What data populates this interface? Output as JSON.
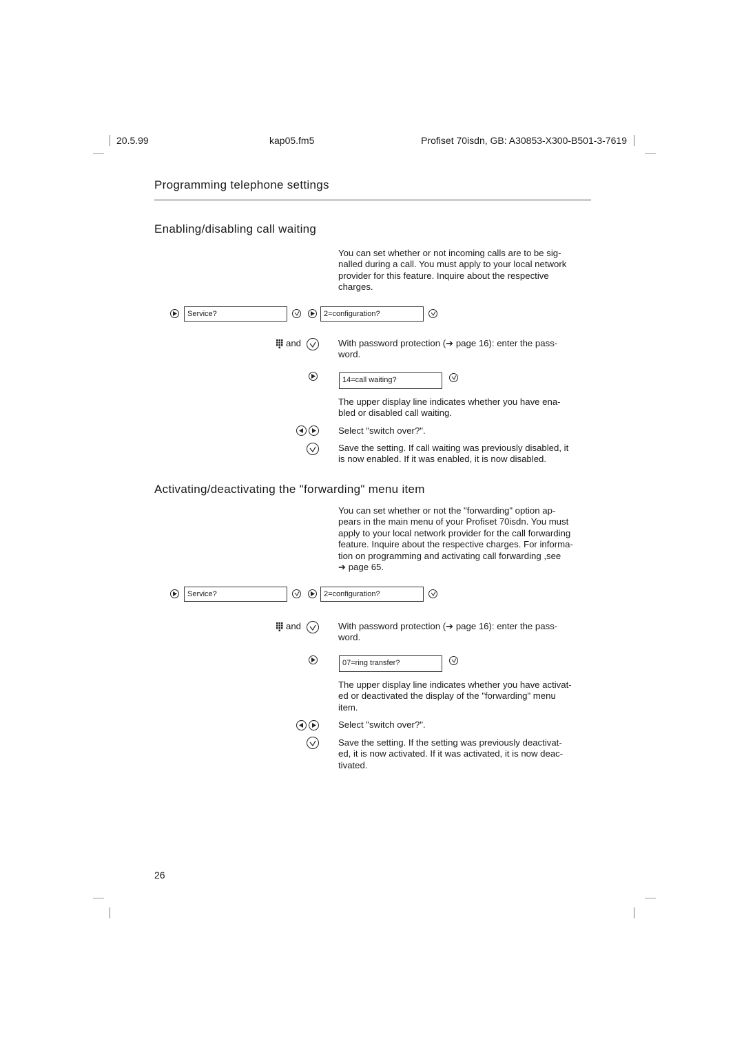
{
  "header": {
    "date": "20.5.99",
    "file": "kap05.fm5",
    "doc_id": "Profiset 70isdn, GB: A30853-X300-B501-3-7619"
  },
  "chapter_title": "Programming telephone settings",
  "sections": [
    {
      "title": "Enabling/disabling call waiting",
      "intro": "You can set whether or not incoming calls are to be sig- nalled during a call. You must apply to your local network provider for this feature. Inquire about the respective charges.",
      "intro_lines": [
        "You can set whether or not incoming calls are to be sig-",
        "nalled during a call. You must apply to your local network",
        "provider for this feature. Inquire about the respective",
        "charges."
      ],
      "display_service": "Service?",
      "display_config": "2=configuration?",
      "keypad_and": "and",
      "password_lines": [
        "With password protection (➔ page 16): enter the pass-",
        "word."
      ],
      "display_item": "14=call waiting?",
      "upper_lines": [
        "The upper display line indicates whether you have ena-",
        "bled or disabled call waiting."
      ],
      "select_text": "Select \"switch over?\".",
      "save_lines": [
        "Save the setting. If call waiting was previously disabled, it",
        "is now enabled. If it was enabled, it is now disabled."
      ]
    },
    {
      "title": "Activating/deactivating the \"forwarding\" menu item",
      "intro_lines": [
        "You can set whether or not the \"forwarding\" option ap-",
        "pears in the main menu of your Profiset 70isdn. You must",
        "apply to your local network provider for the call forwarding",
        "feature. Inquire about the respective charges. For informa-",
        "tion on programming and activating call forwarding ,see",
        "➔ page 65."
      ],
      "display_service": "Service?",
      "display_config": "2=configuration?",
      "keypad_and": "and",
      "password_lines": [
        "With password protection (➔ page 16): enter the pass-",
        "word."
      ],
      "display_item": "07=ring transfer?",
      "upper_lines": [
        "The upper display line indicates whether you have activat-",
        "ed or deactivated the display of the \"forwarding\" menu",
        "item."
      ],
      "select_text": "Select \"switch over?\".",
      "save_lines": [
        "Save the setting. If the setting was previously deactivat-",
        "ed, it is now activated. If it was activated, it is now deac-",
        "tivated."
      ]
    }
  ],
  "page_number": "26",
  "icons": {
    "right": "right-arrow-key-icon",
    "left": "left-arrow-key-icon",
    "ok": "ok-checkmark-key-icon",
    "keypad": "keypad-icon"
  }
}
